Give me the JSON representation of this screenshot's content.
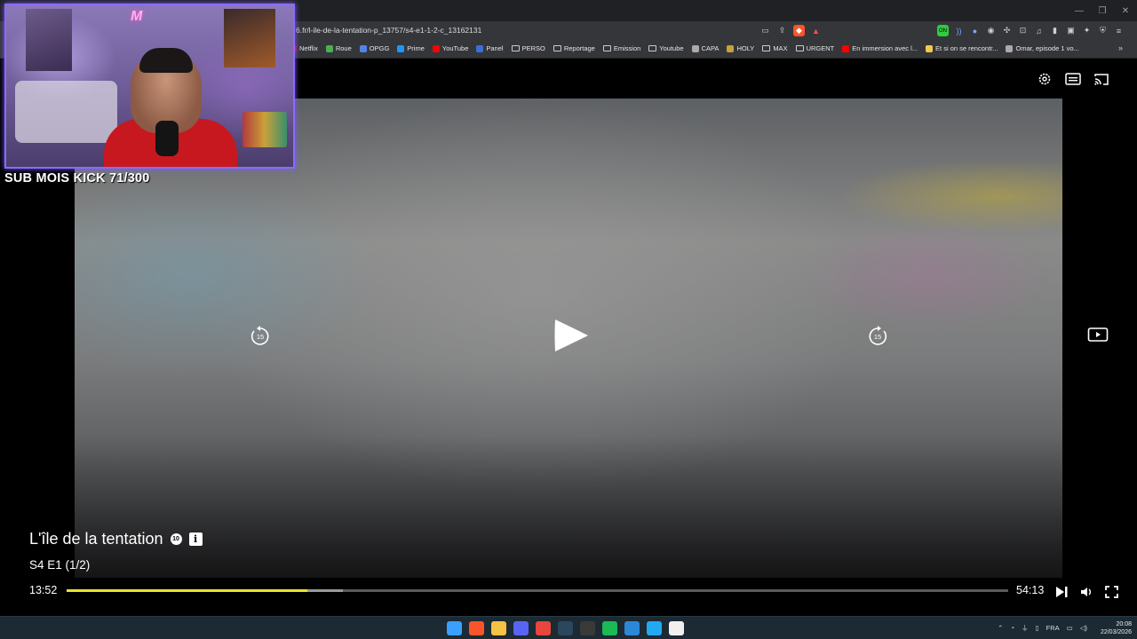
{
  "browser": {
    "url": "6.fr/l-ile-de-la-tentation-p_13757/s4-e1-1-2-c_13162131",
    "bookmarks": [
      {
        "label": "Netflix",
        "icon": "netflix-icon",
        "color": "#e50914"
      },
      {
        "label": "Roue",
        "icon": "wheel-icon",
        "color": "#4caf50"
      },
      {
        "label": "OPGG",
        "icon": "opgg-icon",
        "color": "#5383e8"
      },
      {
        "label": "Prime",
        "icon": "prime-icon",
        "color": "#1a98ff"
      },
      {
        "label": "YouTube",
        "icon": "youtube-icon",
        "color": "#ff0000"
      },
      {
        "label": "Panel",
        "icon": "panel-icon",
        "color": "#3b6fd8"
      },
      {
        "label": "PERSO",
        "icon": "folder-icon",
        "color": ""
      },
      {
        "label": "Reportage",
        "icon": "folder-icon",
        "color": ""
      },
      {
        "label": "Emission",
        "icon": "folder-icon",
        "color": ""
      },
      {
        "label": "Youtube",
        "icon": "folder-icon",
        "color": ""
      },
      {
        "label": "CAPA",
        "icon": "globe-icon",
        "color": "#aaaaaa"
      },
      {
        "label": "HOLY",
        "icon": "holy-icon",
        "color": "#c9a13a"
      },
      {
        "label": "MAX",
        "icon": "folder-icon",
        "color": ""
      },
      {
        "label": "URGENT",
        "icon": "folder-icon",
        "color": ""
      },
      {
        "label": "En immersion avec l...",
        "icon": "youtube-icon",
        "color": "#ff0000"
      },
      {
        "label": "Et si on se rencontr...",
        "icon": "bolt-icon",
        "color": "#f2c94c"
      },
      {
        "label": "Omar, episode 1 vo...",
        "icon": "globe-icon",
        "color": "#aaaaaa"
      }
    ],
    "bookmarks_more": "»"
  },
  "stream_overlay": {
    "sub_goal": "SUB MOIS KICK 71/300",
    "neon_sign": "M"
  },
  "player": {
    "show_title": "L'île de la tentation",
    "age_rating": "10",
    "episode": "S4 E1 (1/2)",
    "current_time": "13:52",
    "duration": "54:13",
    "skip_back_seconds": "15",
    "skip_forward_seconds": "15",
    "progress_fraction": 0.256,
    "buffered_fraction": 0.293,
    "progress_color": "#e9e52b"
  },
  "taskbar": {
    "language": "FRA",
    "time": "20:08",
    "date": "22/03/2026",
    "apps": [
      {
        "name": "windows-start-icon",
        "color": "#3aa0ff"
      },
      {
        "name": "brave-icon",
        "color": "#fb542b"
      },
      {
        "name": "file-explorer-icon",
        "color": "#f6c344"
      },
      {
        "name": "discord-icon",
        "color": "#5865f2"
      },
      {
        "name": "chrome-icon",
        "color": "#e8453c"
      },
      {
        "name": "steam-icon",
        "color": "#2a475e"
      },
      {
        "name": "obs-icon",
        "color": "#3a3a3a"
      },
      {
        "name": "spotify-icon",
        "color": "#1db954"
      },
      {
        "name": "photos-icon",
        "color": "#2b88d8"
      },
      {
        "name": "vscode-icon",
        "color": "#23a9f2"
      },
      {
        "name": "document-icon",
        "color": "#f0f0f0"
      }
    ]
  }
}
